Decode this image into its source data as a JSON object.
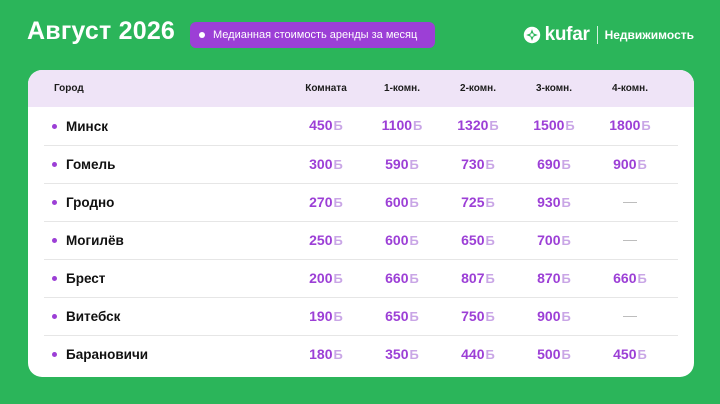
{
  "header": {
    "title": "Август 2026",
    "pill_label": "Медианная стоимость аренды за месяц",
    "brand_name": "kufar",
    "brand_section": "Недвижимость"
  },
  "colors": {
    "background": "#2bb55a",
    "accent": "#9c3fd6",
    "header_row": "#efe4f7",
    "currency_mark": "#c9a6e6"
  },
  "table": {
    "columns": [
      "Город",
      "Комната",
      "1-комн.",
      "2-комн.",
      "3-комн.",
      "4-комн."
    ],
    "currency_symbol": "Ƃ",
    "empty_marker": "—",
    "rows": [
      {
        "city": "Минск",
        "values": [
          "450",
          "1100",
          "1320",
          "1500",
          "1800"
        ]
      },
      {
        "city": "Гомель",
        "values": [
          "300",
          "590",
          "730",
          "690",
          "900"
        ]
      },
      {
        "city": "Гродно",
        "values": [
          "270",
          "600",
          "725",
          "930",
          null
        ]
      },
      {
        "city": "Могилёв",
        "values": [
          "250",
          "600",
          "650",
          "700",
          null
        ]
      },
      {
        "city": "Брест",
        "values": [
          "200",
          "660",
          "807",
          "870",
          "660"
        ]
      },
      {
        "city": "Витебск",
        "values": [
          "190",
          "650",
          "750",
          "900",
          null
        ]
      },
      {
        "city": "Барановичи",
        "values": [
          "180",
          "350",
          "440",
          "500",
          "450"
        ]
      }
    ]
  }
}
